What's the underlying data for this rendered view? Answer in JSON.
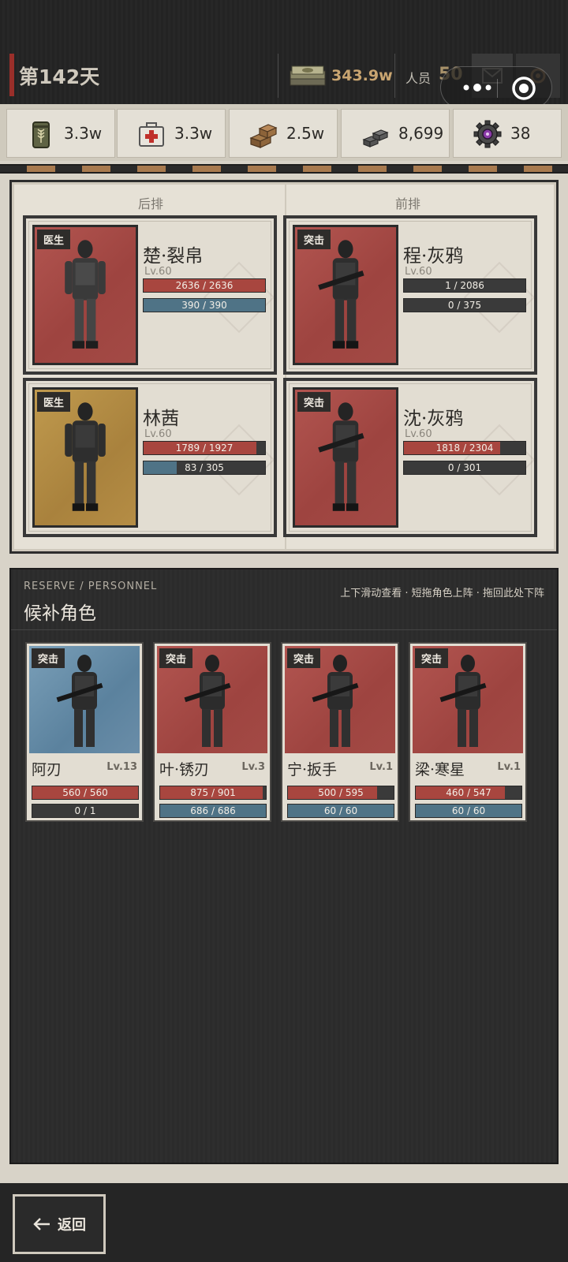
{
  "header": {
    "day_label": "第142天",
    "money_value": "343.9w",
    "people_label": "人员",
    "people_value": "50",
    "icons": [
      "cash-icon",
      "mail-icon",
      "gear-icon",
      "more-dots-icon",
      "target-icon"
    ]
  },
  "resources": [
    {
      "name": "grain",
      "icon": "grain-sack-icon",
      "value": "3.3w"
    },
    {
      "name": "medicine",
      "icon": "medkit-icon",
      "value": "3.3w"
    },
    {
      "name": "materials",
      "icon": "crates-icon",
      "value": "2.5w"
    },
    {
      "name": "metal",
      "icon": "ingots-icon",
      "value": "8,699"
    },
    {
      "name": "parts",
      "icon": "cog-part-icon",
      "value": "38"
    }
  ],
  "formation": {
    "back_title": "后排",
    "front_title": "前排",
    "slots": [
      {
        "role": "医生",
        "name": "楚·裂帛",
        "level": "Lv.60",
        "hp": "2636 / 2636",
        "hp_frac": 1.0,
        "sp": "390 / 390",
        "sp_frac": 1.0,
        "tone": "red"
      },
      {
        "role": "突击",
        "name": "程·灰鸦",
        "level": "Lv.60",
        "hp": "1 / 2086",
        "hp_frac": 0.0005,
        "sp": "0 / 375",
        "sp_frac": 0.0,
        "tone": "red"
      },
      {
        "role": "医生",
        "name": "林茜",
        "level": "Lv.60",
        "hp": "1789 / 1927",
        "hp_frac": 0.928,
        "sp": "83 / 305",
        "sp_frac": 0.272,
        "tone": "gold"
      },
      {
        "role": "突击",
        "name": "沈·灰鸦",
        "level": "Lv.60",
        "hp": "1818 / 2304",
        "hp_frac": 0.789,
        "sp": "0 / 301",
        "sp_frac": 0.0,
        "tone": "red"
      }
    ]
  },
  "reserve": {
    "subtitle": "RESERVE / PERSONNEL",
    "title": "候补角色",
    "hint": "上下滑动查看 · 短拖角色上阵 · 拖回此处下阵",
    "cards": [
      {
        "role": "突击",
        "name": "阿刃",
        "level": "Lv.13",
        "hp": "560 / 560",
        "hp_frac": 1.0,
        "sp": "0 / 1",
        "sp_frac": 0.0,
        "tone": "blue"
      },
      {
        "role": "突击",
        "name": "叶·锈刃",
        "level": "Lv.3",
        "hp": "875 / 901",
        "hp_frac": 0.971,
        "sp": "686 / 686",
        "sp_frac": 1.0,
        "tone": "red"
      },
      {
        "role": "突击",
        "name": "宁·扳手",
        "level": "Lv.1",
        "hp": "500 / 595",
        "hp_frac": 0.84,
        "sp": "60 / 60",
        "sp_frac": 1.0,
        "tone": "red"
      },
      {
        "role": "突击",
        "name": "梁·寒星",
        "level": "Lv.1",
        "hp": "460 / 547",
        "hp_frac": 0.841,
        "sp": "60 / 60",
        "sp_frac": 1.0,
        "tone": "red"
      }
    ]
  },
  "footer": {
    "back_label": "返回"
  },
  "colors": {
    "hp": "#a8463f",
    "sp": "#4f7386",
    "accent": "#9a2f2a",
    "money": "#c9a571"
  }
}
